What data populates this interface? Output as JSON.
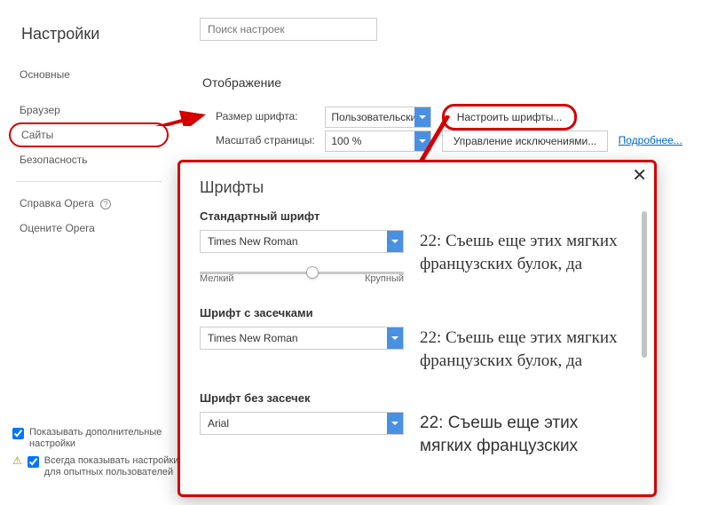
{
  "page_title": "Настройки",
  "search": {
    "placeholder": "Поиск настроек"
  },
  "sidebar": {
    "items": [
      {
        "label": "Основные"
      },
      {
        "label": "Браузер"
      },
      {
        "label": "Сайты"
      },
      {
        "label": "Безопасность"
      },
      {
        "label": "Справка Opera"
      },
      {
        "label": "Оцените Opera"
      }
    ]
  },
  "section": {
    "title": "Отображение"
  },
  "font_size_row": {
    "label": "Размер шрифта:",
    "value": "Пользовательский",
    "configure_btn": "Настроить шрифты..."
  },
  "zoom_row": {
    "label": "Масштаб страницы:",
    "value": "100 %",
    "exceptions_btn": "Управление исключениями...",
    "more_link": "Подробнее..."
  },
  "bottom": {
    "check1": "Показывать дополнительные настройки",
    "check2": "Всегда показывать настройки для опытных пользователей"
  },
  "modal": {
    "title": "Шрифты",
    "standard": {
      "label": "Стандартный шрифт",
      "value": "Times New Roman",
      "slider_min": "Мелкий",
      "slider_max": "Крупный",
      "preview": "22: Съешь еще этих мягких французских булок, да"
    },
    "serif": {
      "label": "Шрифт с засечками",
      "value": "Times New Roman",
      "preview": "22: Съешь еще этих мягких французских булок, да"
    },
    "sans": {
      "label": "Шрифт без засечек",
      "value": "Arial",
      "preview": "22: Съешь еще этих мягких французских"
    }
  }
}
